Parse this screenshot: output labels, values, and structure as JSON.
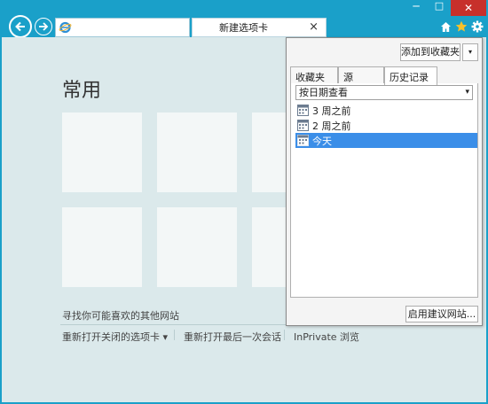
{
  "titlebar": {
    "minimize": "─",
    "maximize": "□",
    "close": "✕"
  },
  "addressbar": {
    "value": "",
    "search_icon": "search-icon",
    "dropdown_icon": "chevron-down-icon",
    "refresh_icon": "refresh-icon"
  },
  "tab": {
    "label": "新建选项卡",
    "close": "×"
  },
  "toolbar": {
    "home_icon": "home-icon",
    "favorites_icon": "star-icon",
    "tools_icon": "gear-icon"
  },
  "page": {
    "title": "常用",
    "find_sites": "寻找你可能喜欢的其他网站",
    "reopen_closed": "重新打开关闭的选项卡 ▾",
    "reopen_last": "重新打开最后一次会话",
    "inprivate": "InPrivate 浏览"
  },
  "panel": {
    "add_favorites": "添加到收藏夹",
    "add_dropdown": "▾",
    "tabs": [
      "收藏夹",
      "源",
      "历史记录"
    ],
    "active_tab": "历史记录",
    "view_select": "按日期查看",
    "history_items": [
      "3 周之前",
      "2 周之前",
      "今天"
    ],
    "selected_item": "今天",
    "enable_suggested": "启用建议网站..."
  },
  "colors": {
    "chrome": "#1aa0c9",
    "content_bg": "#dbe9eb",
    "tile": "#f3f7f7",
    "selection": "#3b8ee8",
    "close_button": "#c7302b"
  }
}
